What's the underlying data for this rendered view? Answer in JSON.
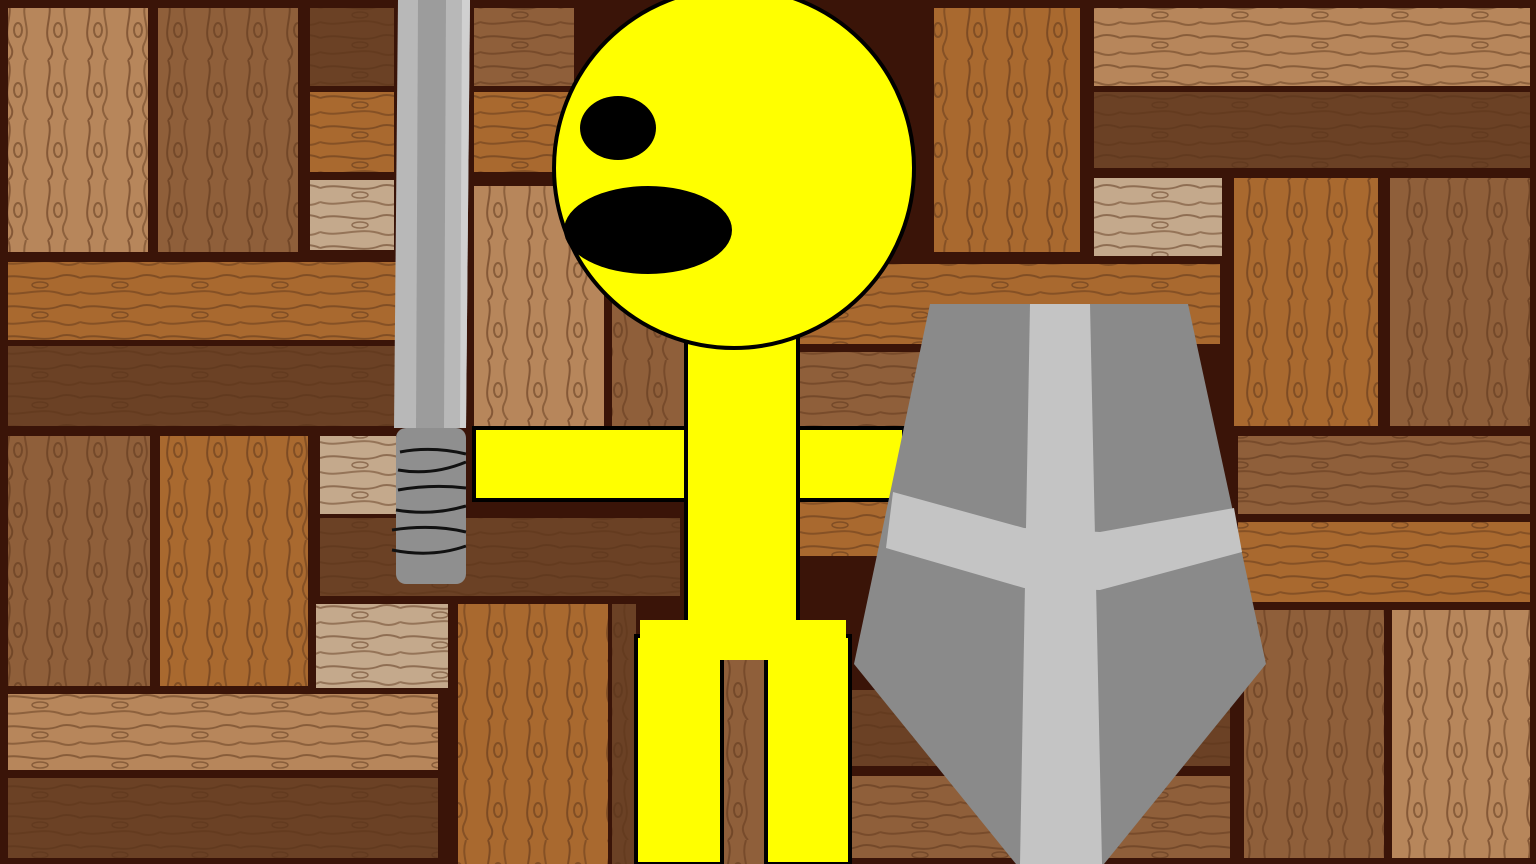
{
  "scene": {
    "background": "wooden-plank-wall",
    "colors": {
      "gap": "#3a1408",
      "wood_light": "#b7865b",
      "wood_mid": "#8f5f3a",
      "wood_dark": "#6b4125",
      "wood_orange": "#a9692f",
      "wood_pale": "#c4a98c",
      "grain": "#5a3319",
      "character_body": "#ffff00",
      "character_outline": "#000000",
      "sword_blade": "#b8b8b8",
      "sword_edge": "#d0d0d0",
      "sword_grip": "#8f8f8f",
      "shield_face": "#8a8a8a",
      "shield_cross": "#c4c4c4"
    }
  },
  "character": {
    "name_visible": "",
    "expression": "shocked-open-mouth",
    "items": [
      "sword-icon",
      "shield-icon"
    ]
  }
}
